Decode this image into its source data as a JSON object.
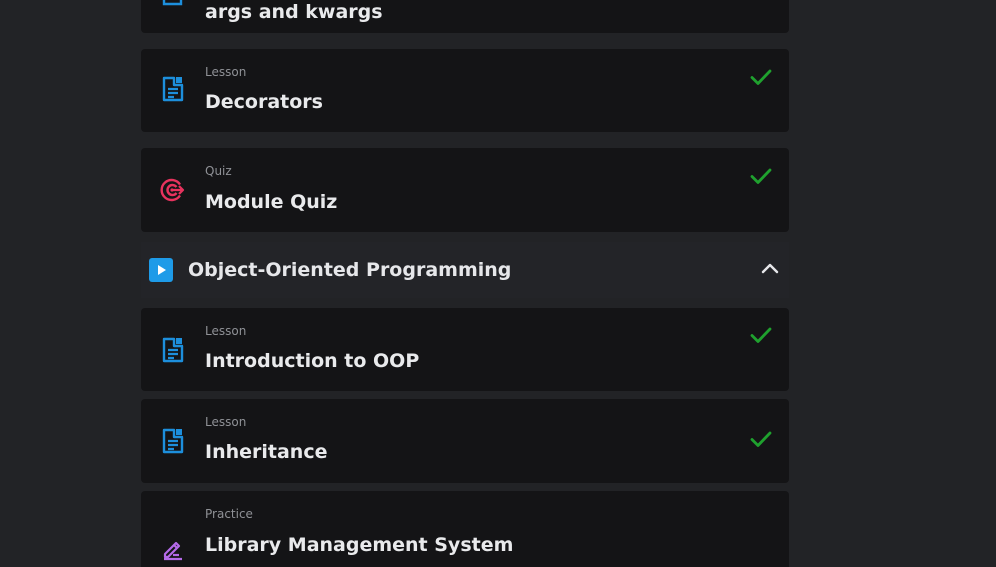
{
  "items_before": [
    {
      "kind": "",
      "title": "args and kwargs",
      "icon": "lesson-doc-icon",
      "completed": false
    },
    {
      "kind": "Lesson",
      "title": "Decorators",
      "icon": "lesson-doc-icon",
      "completed": true
    },
    {
      "kind": "Quiz",
      "title": "Module Quiz",
      "icon": "quiz-target-icon",
      "completed": true
    }
  ],
  "section": {
    "title": "Object-Oriented Programming",
    "icon": "play-icon",
    "expanded": true,
    "toggle_icon": "chevron-up-icon"
  },
  "items_after": [
    {
      "kind": "Lesson",
      "title": "Introduction to OOP",
      "icon": "lesson-doc-icon",
      "completed": true
    },
    {
      "kind": "Lesson",
      "title": "Inheritance",
      "icon": "lesson-doc-icon",
      "completed": true
    },
    {
      "kind": "Practice",
      "title": "Library Management System",
      "icon": "practice-pencil-icon",
      "completed": false
    }
  ],
  "colors": {
    "lesson_icon": "#1d8fdc",
    "quiz_icon": "#e8335e",
    "practice_icon": "#b46ae8",
    "check": "#1fa12e",
    "section_play": "#1e9be8"
  }
}
